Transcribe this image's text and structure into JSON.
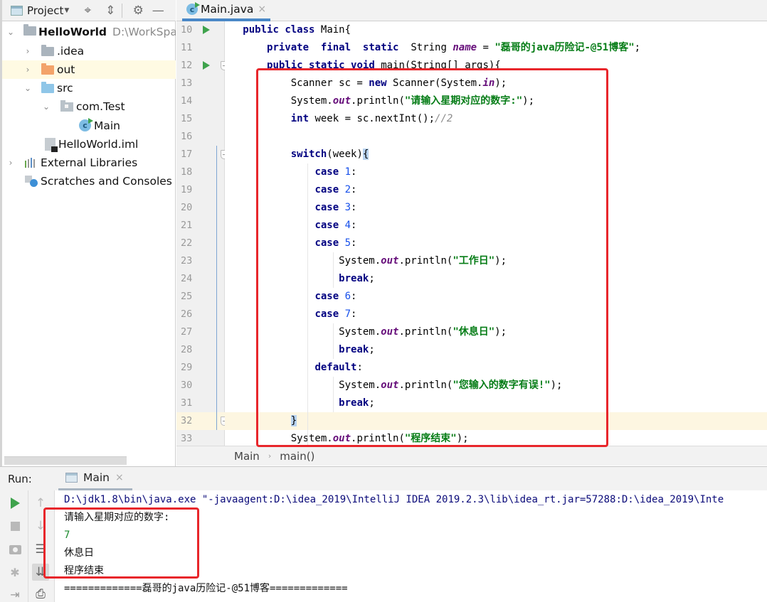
{
  "project_panel": {
    "title": "Project",
    "toolbar_icons": [
      "locate-icon",
      "collapse-all-icon",
      "gear-icon",
      "minimize-icon"
    ],
    "tree": [
      {
        "label": "HelloWorld",
        "path": "D:\\WorkSpace",
        "icon": "module-folder-icon",
        "expanded": true
      },
      {
        "label": ".idea",
        "icon": "folder-icon",
        "expanded": false
      },
      {
        "label": "out",
        "icon": "excluded-folder-icon",
        "expanded": false,
        "selected": true
      },
      {
        "label": "src",
        "icon": "source-folder-icon",
        "expanded": true
      },
      {
        "label": "com.Test",
        "icon": "package-icon",
        "expanded": true
      },
      {
        "label": "Main",
        "icon": "java-class-icon"
      },
      {
        "label": "HelloWorld.iml",
        "icon": "iml-file-icon"
      },
      {
        "label": "External Libraries",
        "icon": "library-icon",
        "expanded": false
      },
      {
        "label": "Scratches and Consoles",
        "icon": "scratches-icon"
      }
    ]
  },
  "editor": {
    "tab": {
      "label": "Main.java",
      "close": "×"
    },
    "lines": [
      {
        "no": "10",
        "text": "public class Main{"
      },
      {
        "no": "11",
        "text": "    private  final  static  String name = \"磊哥的java历险记-@51博客\";"
      },
      {
        "no": "12",
        "text": "    public static void main(String[] args){"
      },
      {
        "no": "13",
        "text": "        Scanner sc = new Scanner(System.in);"
      },
      {
        "no": "14",
        "text": "        System.out.println(\"请输入星期对应的数字:\");"
      },
      {
        "no": "15",
        "text": "        int week = sc.nextInt();//2"
      },
      {
        "no": "16",
        "text": ""
      },
      {
        "no": "17",
        "text": "        switch(week){"
      },
      {
        "no": "18",
        "text": "            case 1:"
      },
      {
        "no": "19",
        "text": "            case 2:"
      },
      {
        "no": "20",
        "text": "            case 3:"
      },
      {
        "no": "21",
        "text": "            case 4:"
      },
      {
        "no": "22",
        "text": "            case 5:"
      },
      {
        "no": "23",
        "text": "                System.out.println(\"工作日\");"
      },
      {
        "no": "24",
        "text": "                break;"
      },
      {
        "no": "25",
        "text": "            case 6:"
      },
      {
        "no": "26",
        "text": "            case 7:"
      },
      {
        "no": "27",
        "text": "                System.out.println(\"休息日\");"
      },
      {
        "no": "28",
        "text": "                break;"
      },
      {
        "no": "29",
        "text": "            default:"
      },
      {
        "no": "30",
        "text": "                System.out.println(\"您输入的数字有误!\");"
      },
      {
        "no": "31",
        "text": "                break;"
      },
      {
        "no": "32",
        "text": "        }"
      },
      {
        "no": "33",
        "text": "        System.out.println(\"程序结束\");"
      }
    ],
    "breadcrumb": [
      "Main",
      "main()"
    ],
    "breadcrumb_separator": "›"
  },
  "run_panel": {
    "label": "Run:",
    "tab": {
      "label": "Main",
      "close": "×"
    },
    "console": [
      {
        "type": "cmd",
        "text": "D:\\jdk1.8\\bin\\java.exe \"-javaagent:D:\\idea_2019\\IntelliJ IDEA 2019.2.3\\lib\\idea_rt.jar=57288:D:\\idea_2019\\Inte"
      },
      {
        "type": "output",
        "text": "请输入星期对应的数字:"
      },
      {
        "type": "input",
        "text": "7"
      },
      {
        "type": "output",
        "text": "休息日"
      },
      {
        "type": "output",
        "text": "程序结束"
      },
      {
        "type": "output",
        "text": "=============磊哥的java历险记-@51博客============="
      }
    ]
  },
  "colors": {
    "keyword": "#000080",
    "string": "#067d17",
    "static_field": "#660e7a",
    "number": "#1750eb",
    "comment": "#8c8c8c",
    "highlight_box": "#e8262b",
    "current_line": "#fdf6e1",
    "run_icon": "#3fa34d"
  }
}
